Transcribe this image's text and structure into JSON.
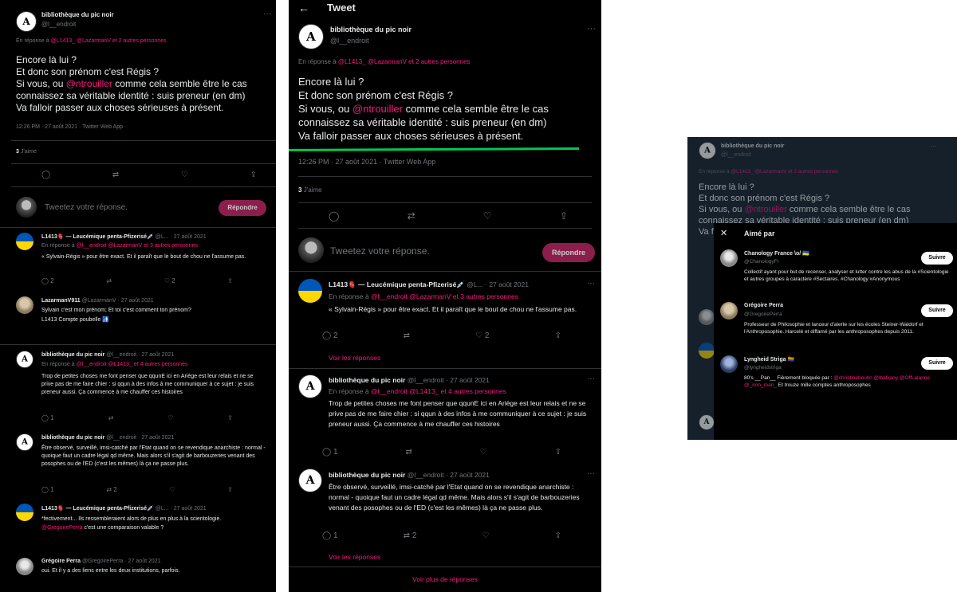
{
  "main_tweet": {
    "author": "bibliothèque du pic noir",
    "handle": "@l__endroit",
    "reply_prefix": "En réponse à",
    "reply_to": "@L1413_ @LazarmanV",
    "reply_more": "et 2 autres personnes",
    "line1": "Encore là lui ?",
    "line2": "Et donc son prénom c'est Régis ?",
    "line3_a": "Si vous, ou",
    "line3_mention": "@ntrouiller",
    "line3_b": "comme cela semble être le cas",
    "line4": "connaissez sa véritable identité : suis preneur (en dm)",
    "line5": "Va falloir passer aux choses sérieuses à présent.",
    "timestamp": "12:26 PM · 27 août 2021 · Twitter Web App",
    "likes_count": "3",
    "likes_label": "J'aime",
    "reply_placeholder": "Tweetez votre réponse.",
    "reply_button": "Répondre"
  },
  "header": {
    "title": "Tweet",
    "back_icon": "arrow-left-icon"
  },
  "replies": [
    {
      "author": "L1413🫀 — Leucémique penta-Pfizerisé💉",
      "handle": "@L...",
      "date": "· 27 août 2021",
      "reply_to": "@l__endroit @LazarmanV",
      "reply_more": "et 3 autres personnes",
      "text": "« Sylvain-Régis » pour être exact. Et il paraît que le bout de chou ne l'assume pas.",
      "reply_count": "2",
      "like_count": "2",
      "see_replies": "Voir les réponses"
    },
    {
      "author": "bibliothèque du pic noir",
      "handle": "@l__endroit",
      "date": "· 27 août 2021",
      "reply_to": "@l__endroit @L1413_",
      "reply_more": "et 4 autres personnes",
      "text": "Trop de petites choses me font penser que qqunE ici en Ariège est leur relais et ne se prive pas de me faire chier : si qqun à des infos à me communiquer à ce sujet : je suis preneur aussi. Ça commence à me chauffer ces histoires",
      "reply_count": "1"
    },
    {
      "author": "bibliothèque du pic noir",
      "handle": "@l__endroit",
      "date": "· 27 août 2021",
      "text": "Être observé, surveillé, imsi-catché par l'Etat quand on se revendique anarchiste : normal - quoique faut un cadre légal qd même. Mais alors s'il s'agit de barbouzeries venant des posophes ou de l'ED (c'est les mêmes) là ça ne passe plus.",
      "reply_count": "1",
      "retweet_count": "2",
      "see_replies": "Voir les réponses"
    }
  ],
  "left_extra": [
    {
      "author": "LazarmanV911",
      "handle": "@LazarmanV",
      "date": "· 27 août 2021",
      "text1": "Sylvain c'est mon prénom; Et toi c'est comment ton prénom?",
      "text2": "L1413 Compte poubelle 🚮"
    },
    {
      "author": "L1413🫀 — Leucémique penta-Pfizerisé💉",
      "handle": "@L...",
      "date": "· 27 août 2021",
      "text1": "*fectivement... Ils ressembleraient alors de plus en plus à la scientologie.",
      "mention": "@GregoirePerra",
      "text2": "c'est une comparaison valable ?"
    },
    {
      "author": "Grégoire Perra",
      "handle": "@GregoirePerra",
      "date": "· 27 août 2021",
      "text1": "oui. Et il y a des liens entre les deux institutions, parfois."
    }
  ],
  "more_replies": "Voir plus de réponses",
  "liked_by": {
    "title": "Aimé par",
    "users": [
      {
        "name": "Chanology France \\o/ 🇺🇦",
        "handle": "@ChanologyFr",
        "bio": "Collectif ayant pour but de recenser, analyser et lutter contre les abus de la #Scientologie et autres groupes à caractère #Sectaires. #Chanology #Anonymous",
        "follow": "Suivre"
      },
      {
        "name": "Grégoire Perra",
        "handle": "@GregoirePerra",
        "bio": "Professeur de Philosophie et lanceur d'alerte sur les écoles Steiner-Waldorf et l'Anthroposophie. Harcelé et diffamé par les anthroposophes depuis 2011.",
        "follow": "Suivre"
      },
      {
        "name": "Lyngheid Striga 🏳️‍🌈",
        "handle": "@lyngheidstriga",
        "bio_a": "80's __Pan__ Fièrement bloquée par :",
        "bio_mentions": "@christineboutin @lbalkany @OffLalanne @_iron_man_",
        "bio_b": "Et trouze mille comptes anthroposophes",
        "follow": "Suivre"
      }
    ]
  },
  "colors": {
    "accent": "#f91880",
    "background": "#000000",
    "dim_bg": "#15202b",
    "highlight": "#00c853"
  }
}
